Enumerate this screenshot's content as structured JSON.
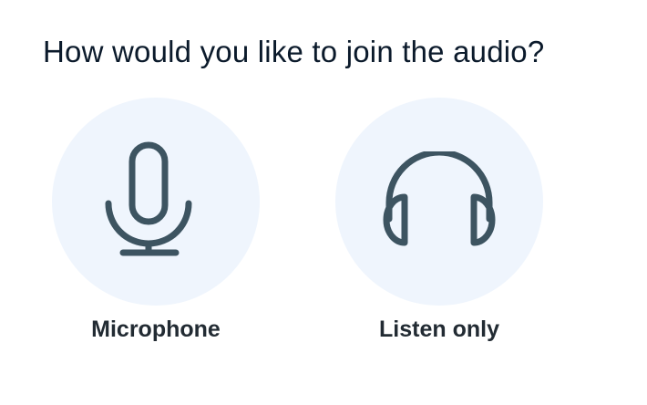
{
  "dialog": {
    "title": "How would you like to join the audio?",
    "options": [
      {
        "label": "Microphone",
        "icon": "microphone-icon"
      },
      {
        "label": "Listen only",
        "icon": "headphones-icon"
      }
    ]
  },
  "colors": {
    "icon": "#3d5461",
    "circle_bg": "#eff5fd",
    "title_text": "#0b1a2b",
    "label_text": "#222b33"
  }
}
